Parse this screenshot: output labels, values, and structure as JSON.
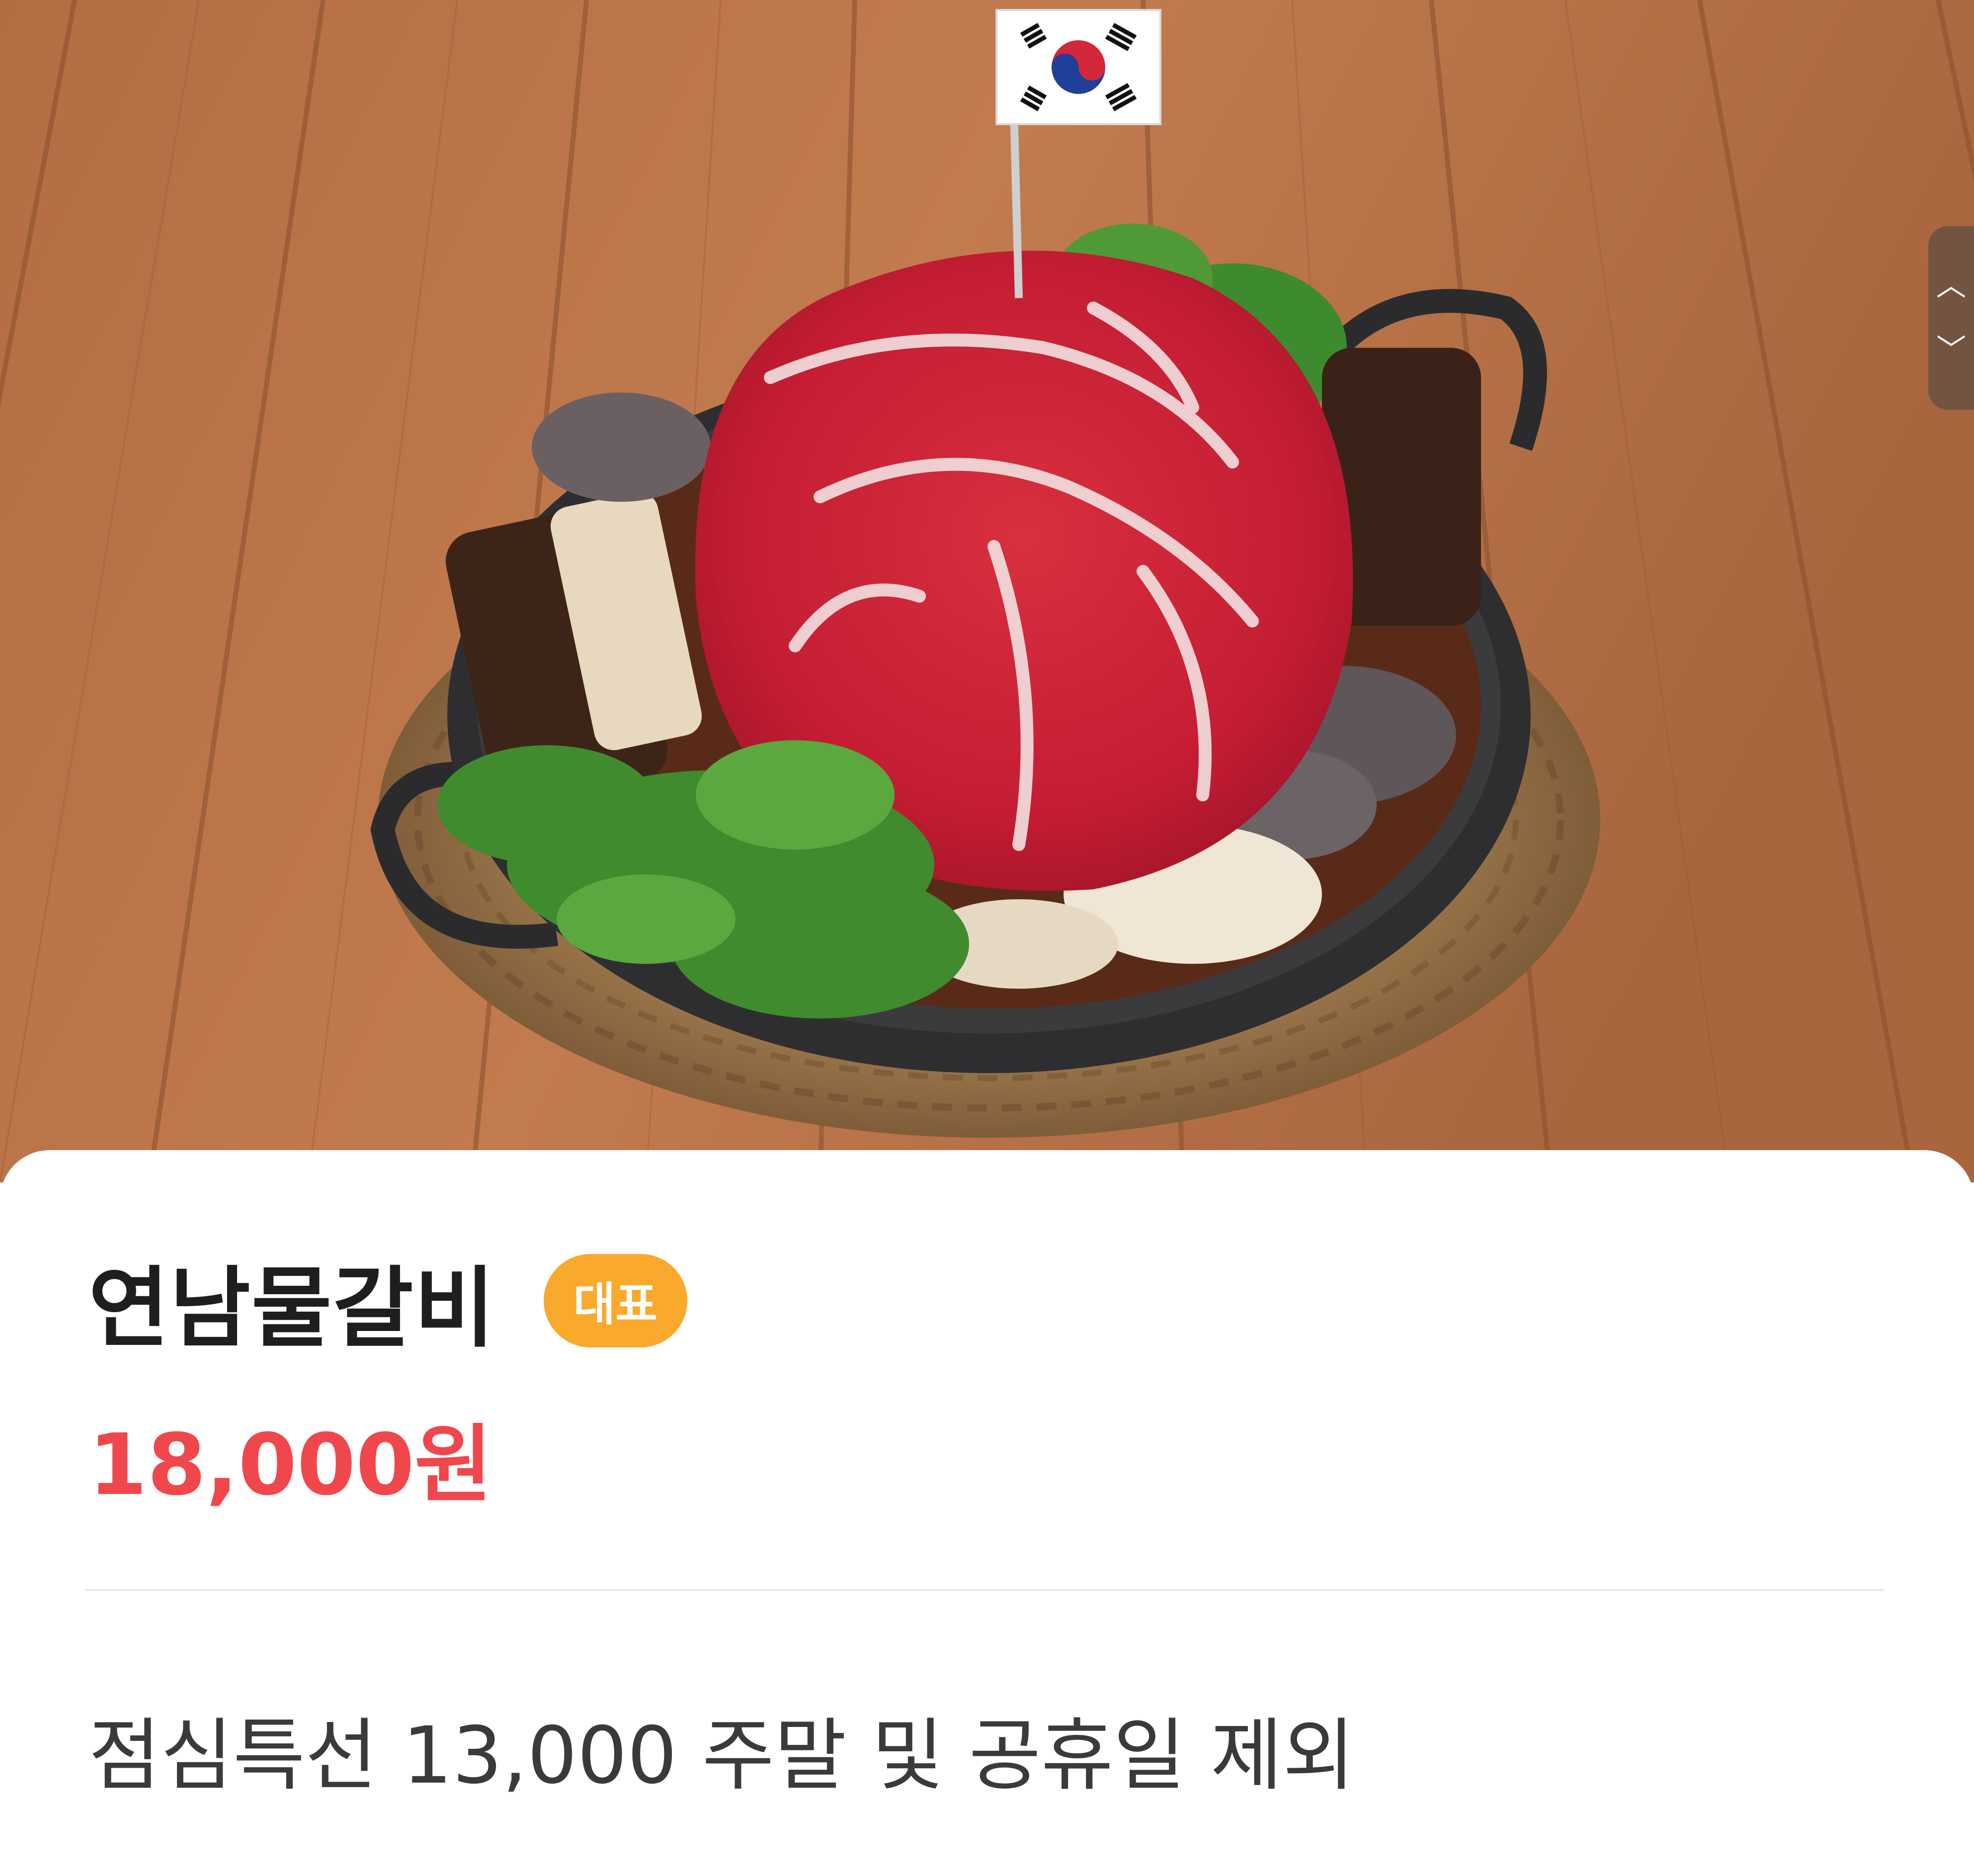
{
  "menu": {
    "name": "연남물갈비",
    "badge": "대표",
    "price": "18,000원",
    "description": "점심특선 13,000 주말 및 공휴일 제외"
  },
  "scroll_handle": {
    "up_icon": "chevron-up-icon",
    "down_icon": "chevron-down-icon"
  },
  "colors": {
    "price": "#f0474d",
    "badge": "#f9a92c",
    "title": "#1e1e1e",
    "description": "#3a3a3a"
  }
}
